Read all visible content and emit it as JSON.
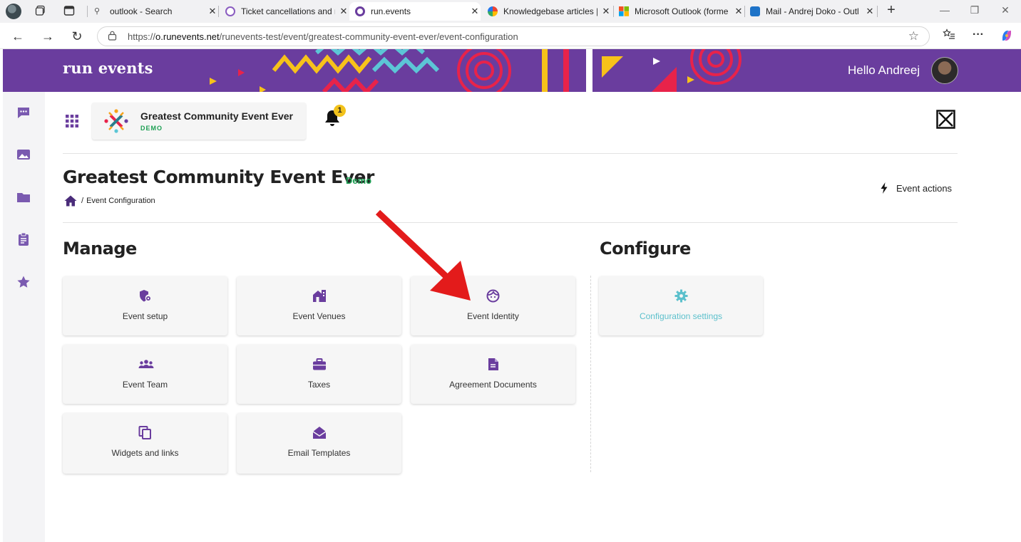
{
  "browser": {
    "tabs": [
      {
        "title": "outlook - Search",
        "active": false
      },
      {
        "title": "Ticket cancellations and n",
        "active": false
      },
      {
        "title": "run.events",
        "active": true
      },
      {
        "title": "Knowledgebase articles | r",
        "active": false
      },
      {
        "title": "Microsoft Outlook (forme",
        "active": false
      },
      {
        "title": "Mail - Andrej Doko - Outl",
        "active": false
      }
    ],
    "url_prefix": "https://",
    "url_host": "o.runevents.net",
    "url_path": "/runevents-test/event/greatest-community-event-ever/event-configuration"
  },
  "header": {
    "logo": "run events",
    "greeting": "Hello Andreej"
  },
  "event_card": {
    "name": "Greatest Community Event Ever",
    "badge": "DEMO",
    "notification_count": "1"
  },
  "page": {
    "title": "Greatest Community Event Ever",
    "title_badge": "Demo",
    "breadcrumb_sep": "/",
    "breadcrumb_current": "Event Configuration",
    "event_actions": "Event actions"
  },
  "manage": {
    "title": "Manage",
    "tiles": [
      {
        "label": "Event setup",
        "icon": "shield-gear-icon"
      },
      {
        "label": "Event Venues",
        "icon": "venue-icon"
      },
      {
        "label": "Event Identity",
        "icon": "face-icon"
      },
      {
        "label": "Event Team",
        "icon": "team-icon"
      },
      {
        "label": "Taxes",
        "icon": "briefcase-icon"
      },
      {
        "label": "Agreement Documents",
        "icon": "document-icon"
      },
      {
        "label": "Widgets and links",
        "icon": "copy-icon"
      },
      {
        "label": "Email Templates",
        "icon": "envelope-open-icon"
      }
    ]
  },
  "configure": {
    "title": "Configure",
    "tiles": [
      {
        "label": "Configuration settings",
        "icon": "gear-icon"
      }
    ]
  },
  "colors": {
    "brand_purple": "#6a3d9e",
    "demo_green": "#1ea054",
    "config_teal": "#5cc0cc",
    "annotation_red": "#e31b1b"
  }
}
